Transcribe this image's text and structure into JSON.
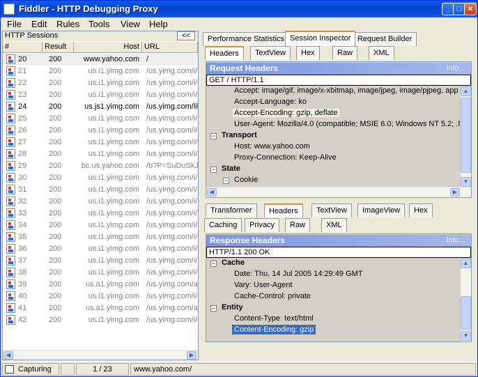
{
  "window": {
    "title": "Fiddler - HTTP Debugging Proxy",
    "min": "_",
    "max": "□",
    "close": "×"
  },
  "menu": [
    {
      "label": "File"
    },
    {
      "label": "Edit"
    },
    {
      "label": "Rules"
    },
    {
      "label": "Tools"
    },
    {
      "label": "View"
    },
    {
      "label": "Help"
    }
  ],
  "sessions": {
    "title": "HTTP Sessions",
    "collapse": "<<",
    "columns": {
      "num": "#",
      "result": "Result",
      "host": "Host",
      "url": "URL"
    },
    "rows": [
      {
        "num": "20",
        "result": "200",
        "host": "www.yahoo.com",
        "url": "/",
        "active": true
      },
      {
        "num": "21",
        "result": "200",
        "host": "us.i1.yimg.com",
        "url": "/us.yimg.com/i/"
      },
      {
        "num": "22",
        "result": "200",
        "host": "us.i1.yimg.com",
        "url": "/us.yimg.com/i/"
      },
      {
        "num": "23",
        "result": "200",
        "host": "us.i1.yimg.com",
        "url": "/us.yimg.com/i/"
      },
      {
        "num": "24",
        "result": "200",
        "host": "us.js1.yimg.com",
        "url": "/us.yimg.com/lib",
        "active": true
      },
      {
        "num": "25",
        "result": "200",
        "host": "us.i1.yimg.com",
        "url": "/us.yimg.com/i/"
      },
      {
        "num": "26",
        "result": "200",
        "host": "us.i1.yimg.com",
        "url": "/us.yimg.com/i/"
      },
      {
        "num": "27",
        "result": "200",
        "host": "us.i1.yimg.com",
        "url": "/us.yimg.com/i/"
      },
      {
        "num": "28",
        "result": "200",
        "host": "us.i1.yimg.com",
        "url": "/us.yimg.com/i/"
      },
      {
        "num": "29",
        "result": "200",
        "host": "bc.us.yahoo.com",
        "url": "/b?P=SuDuSkJe"
      },
      {
        "num": "30",
        "result": "200",
        "host": "us.i1.yimg.com",
        "url": "/us.yimg.com/i/"
      },
      {
        "num": "31",
        "result": "200",
        "host": "us.i1.yimg.com",
        "url": "/us.yimg.com/i/"
      },
      {
        "num": "32",
        "result": "200",
        "host": "us.i1.yimg.com",
        "url": "/us.yimg.com/i/"
      },
      {
        "num": "33",
        "result": "200",
        "host": "us.i1.yimg.com",
        "url": "/us.yimg.com/i/"
      },
      {
        "num": "34",
        "result": "200",
        "host": "us.i1.yimg.com",
        "url": "/us.yimg.com/i/"
      },
      {
        "num": "35",
        "result": "200",
        "host": "us.i1.yimg.com",
        "url": "/us.yimg.com/i/"
      },
      {
        "num": "36",
        "result": "200",
        "host": "us.i1.yimg.com",
        "url": "/us.yimg.com/i/"
      },
      {
        "num": "37",
        "result": "200",
        "host": "us.i1.yimg.com",
        "url": "/us.yimg.com/i/"
      },
      {
        "num": "38",
        "result": "200",
        "host": "us.i1.yimg.com",
        "url": "/us.yimg.com/i/"
      },
      {
        "num": "39",
        "result": "200",
        "host": "us.a1.yimg.com",
        "url": "/us.yimg.com/a/"
      },
      {
        "num": "40",
        "result": "200",
        "host": "us.i1.yimg.com",
        "url": "/us.yimg.com/i/"
      },
      {
        "num": "41",
        "result": "200",
        "host": "us.a1.yimg.com",
        "url": "/us.yimg.com/a/"
      },
      {
        "num": "42",
        "result": "200",
        "host": "us.i1.yimg.com",
        "url": "/us.yimg.com/i/"
      }
    ]
  },
  "top_tabs": [
    "Performance Statistics",
    "Session Inspector",
    "Request Builder"
  ],
  "req_tabs": [
    "Headers",
    "TextView",
    "Hex",
    "Raw",
    "XML"
  ],
  "request": {
    "title": "Request Headers",
    "info": "Info...",
    "start": "GET / HTTP/1.1",
    "lines": [
      {
        "text": "Accept: image/gif, image/x-xbitmap, image/jpeg, image/pjpeg, app",
        "kind": "item"
      },
      {
        "text": "Accept-Language: ko",
        "kind": "item"
      },
      {
        "text": "Accept-Encoding: gzip, deflate",
        "kind": "item",
        "hl": true
      },
      {
        "text": "User-Agent: Mozilla/4.0 (compatible; MSIE 6.0; Windows NT 5.2; .N",
        "kind": "item"
      },
      {
        "text": "Transport",
        "kind": "group"
      },
      {
        "text": "Host: www.yahoo.com",
        "kind": "item"
      },
      {
        "text": "Proxy-Connection: Keep-Alive",
        "kind": "item"
      },
      {
        "text": "State",
        "kind": "group"
      },
      {
        "text": "Cookie",
        "kind": "sub"
      }
    ]
  },
  "resp_tabs_row1": [
    "Transformer",
    "Headers",
    "TextView",
    "ImageView",
    "Hex"
  ],
  "resp_tabs_row2": [
    "Caching",
    "Privacy",
    "Raw",
    "XML"
  ],
  "response": {
    "title": "Response Headers",
    "info": "Info...",
    "start": "HTTP/1.1 200 OK",
    "lines": [
      {
        "text": "Cache",
        "kind": "group"
      },
      {
        "text": "Date: Thu, 14 Jul 2005 14:29:49 GMT",
        "kind": "item"
      },
      {
        "text": "Vary: User-Agent",
        "kind": "item"
      },
      {
        "text": "Cache-Control: private",
        "kind": "item"
      },
      {
        "text": "Entity",
        "kind": "group"
      },
      {
        "text": "Content-Type: text/html",
        "kind": "item"
      },
      {
        "text": "Content-Encoding: gzip",
        "kind": "item",
        "selected": true
      }
    ]
  },
  "status": {
    "capture": "Capturing",
    "count": "1 / 23",
    "url": "www.yahoo.com/"
  }
}
